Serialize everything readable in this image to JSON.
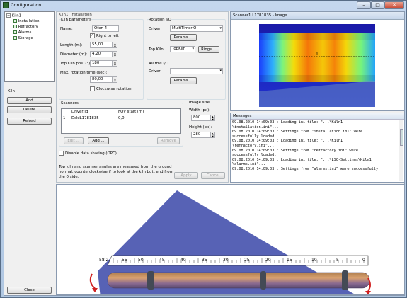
{
  "window": {
    "title": "Configuration",
    "min": "–",
    "max": "□",
    "close": "✕"
  },
  "tree": {
    "root": "Kiln1",
    "items": [
      "Installation",
      "Refractory",
      "Alarms",
      "Storage"
    ]
  },
  "kiln_side": {
    "label": "Kiln",
    "add": "Add",
    "delete": "Delete",
    "reload": "Reload",
    "close": "Close"
  },
  "install": {
    "header": "Kiln1: Installation",
    "params_title": "Kiln parameters",
    "name_label": "Name:",
    "name_value": "Ofen 4",
    "rtl_label": "Right to left",
    "rtl_checked": true,
    "length_label": "Length (m):",
    "length_value": "55,00",
    "diameter_label": "Diameter (m):",
    "diameter_value": "4,20",
    "topkiln_label": "Top Kiln pos. (°):",
    "topkiln_value": "180",
    "maxrot_label": "Max. rotation time (sec):",
    "maxrot_value": "80,00",
    "clockwise_label": "Clockwise rotation",
    "clockwise_checked": false,
    "rotation_title": "Rotation I/O",
    "driver_label": "Driver:",
    "driver_value": "MultiTimerIO",
    "params_btn": "Params ...",
    "topkiln2_label": "Top Kiln:",
    "topkiln2_value": "TopKiln",
    "rings_btn": "Rings ...",
    "alarms_title": "Alarms I/O",
    "alarms_driver_label": "Driver:",
    "alarms_driver_value": "",
    "alarms_params_btn": "Params ...",
    "scanners_title": "Scanners",
    "scanners_cols": [
      "Driver/Id",
      "FOV start (m)"
    ],
    "scanners_rows": [
      {
        "num": "1",
        "id": "DskIL1781835",
        "fov": "0,0"
      }
    ],
    "edit_btn": "Edit ...",
    "add_btn": "Add ...",
    "remove_btn": "Remove",
    "imgsize_title": "Image size",
    "width_label": "Width (px):",
    "width_value": "800",
    "height_label": "Height (px):",
    "height_value": "280",
    "disable_label": "Disable data sharing (OPC)",
    "disable_checked": false,
    "note": "Top kiln and scanner angles are measured from the ground normal, counterclockwise if to look at the kiln butt end from the 0 side.",
    "apply_btn": "Apply",
    "cancel_btn": "Cancel"
  },
  "scanner_panel": {
    "title": "Scanner1 L1781835 - Image",
    "marker": "1"
  },
  "messages": {
    "title": "Messages",
    "lines": [
      "09.08.2010 14:09:03 : Loading ini file: \"...\\Kiln1",
      "\\installation.ini\"...",
      "09.08.2010 14:09:03 : Settings from \"installation.ini\" were",
      "successfully loaded.",
      "09.08.2010 14:09:03 : Loading ini file: \"...\\Kiln1",
      "\\refractory.ini\"...",
      "09.08.2010 14:09:03 : Settings from \"refractory.ini\" were",
      "successfully loaded.",
      "09.08.2010 14:09:03 : Loading ini file: \"...\\LSC-Settings\\Kiln1",
      "\\alarms.ini\"...",
      "09.08.2010 14:09:03 : Settings from \"alarms.ini\" were successfully"
    ]
  },
  "ruler": {
    "ticks": [
      "58,2",
      "55",
      "50",
      "45",
      "40",
      "35",
      "30",
      "25",
      "20",
      "15",
      "10",
      "5",
      "0"
    ]
  },
  "colors": {
    "accent": "#3399ff",
    "fov": "#3a46a8"
  }
}
